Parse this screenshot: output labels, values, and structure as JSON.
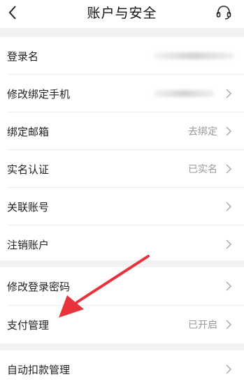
{
  "header": {
    "title": "账户与安全",
    "back_icon": "chevron-left-icon",
    "service_icon": "headset-icon"
  },
  "rows": [
    {
      "label": "登录名",
      "value": "",
      "masked": true
    },
    {
      "label": "修改绑定手机",
      "value": "",
      "masked": true
    },
    {
      "label": "绑定邮箱",
      "value": "去绑定"
    },
    {
      "label": "实名认证",
      "value": "已实名"
    },
    {
      "label": "关联账号",
      "value": ""
    },
    {
      "label": "注销账户",
      "value": ""
    },
    {
      "label": "修改登录密码",
      "value": ""
    },
    {
      "label": "支付管理",
      "value": "已开启"
    },
    {
      "label": "自动扣款管理",
      "value": ""
    }
  ],
  "colors": {
    "background": "#f2f2f2",
    "annotation_arrow": "#e8323c",
    "value_text": "#999999"
  }
}
